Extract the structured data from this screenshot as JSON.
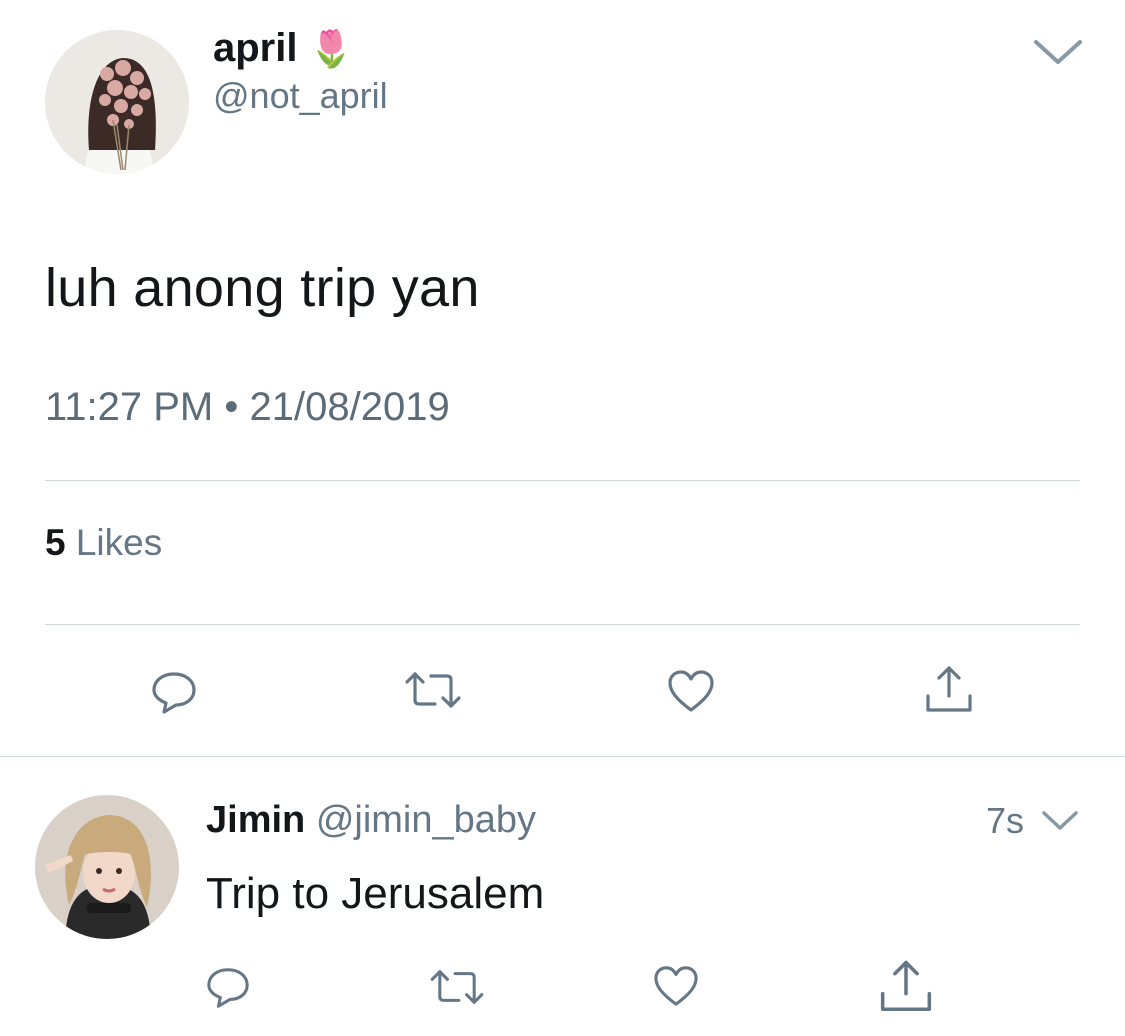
{
  "main_tweet": {
    "author": {
      "display_name": "april",
      "emoji": "🌷",
      "handle": "@not_april"
    },
    "text": "luh anong trip yan",
    "time": "11:27 PM",
    "separator": "•",
    "date": "21/08/2019",
    "likes_count": "5",
    "likes_label": "Likes",
    "icons": {
      "menu": "chevron-down-icon",
      "reply": "reply-icon",
      "retweet": "retweet-icon",
      "like": "heart-icon",
      "share": "share-icon"
    }
  },
  "reply_tweet": {
    "author": {
      "display_name": "Jimin",
      "handle": "@jimin_baby"
    },
    "age": "7s",
    "text": "Trip to Jerusalem"
  },
  "colors": {
    "text": "#14171a",
    "muted": "#657786",
    "icon": "#657786",
    "divider": "#ccd6dd"
  }
}
